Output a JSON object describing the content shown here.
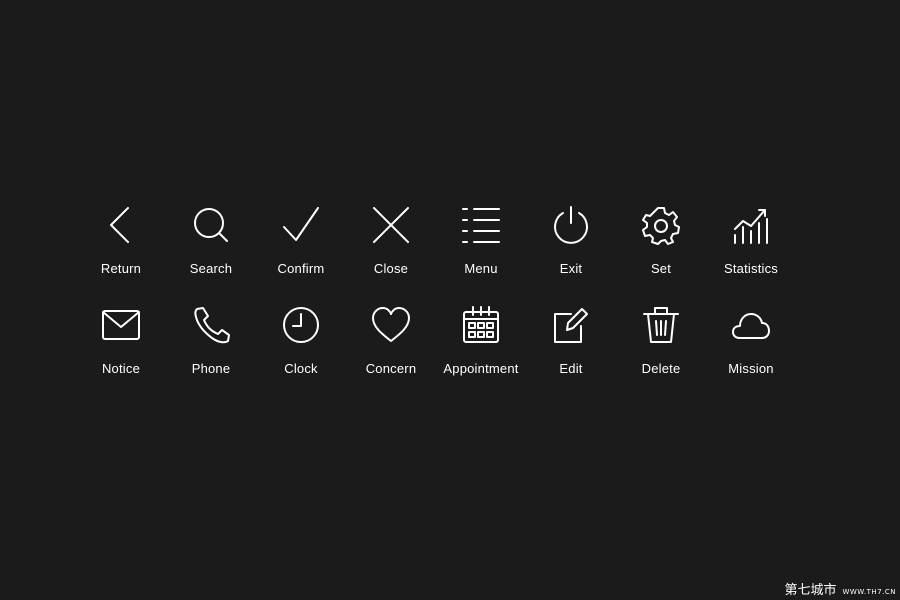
{
  "icons": [
    {
      "name": "return-icon",
      "label": "Return"
    },
    {
      "name": "search-icon",
      "label": "Search"
    },
    {
      "name": "confirm-icon",
      "label": "Confirm"
    },
    {
      "name": "close-icon",
      "label": "Close"
    },
    {
      "name": "menu-icon",
      "label": "Menu"
    },
    {
      "name": "exit-icon",
      "label": "Exit"
    },
    {
      "name": "set-icon",
      "label": "Set"
    },
    {
      "name": "statistics-icon",
      "label": "Statistics"
    },
    {
      "name": "notice-icon",
      "label": "Notice"
    },
    {
      "name": "phone-icon",
      "label": "Phone"
    },
    {
      "name": "clock-icon",
      "label": "Clock"
    },
    {
      "name": "concern-icon",
      "label": "Concern"
    },
    {
      "name": "appointment-icon",
      "label": "Appointment"
    },
    {
      "name": "edit-icon",
      "label": "Edit"
    },
    {
      "name": "delete-icon",
      "label": "Delete"
    },
    {
      "name": "mission-icon",
      "label": "Mission"
    }
  ],
  "watermark": {
    "brand": "第七城市",
    "url": "WWW.TH7.CN"
  },
  "colors": {
    "background": "#1b1b1b",
    "foreground": "#ffffff"
  }
}
